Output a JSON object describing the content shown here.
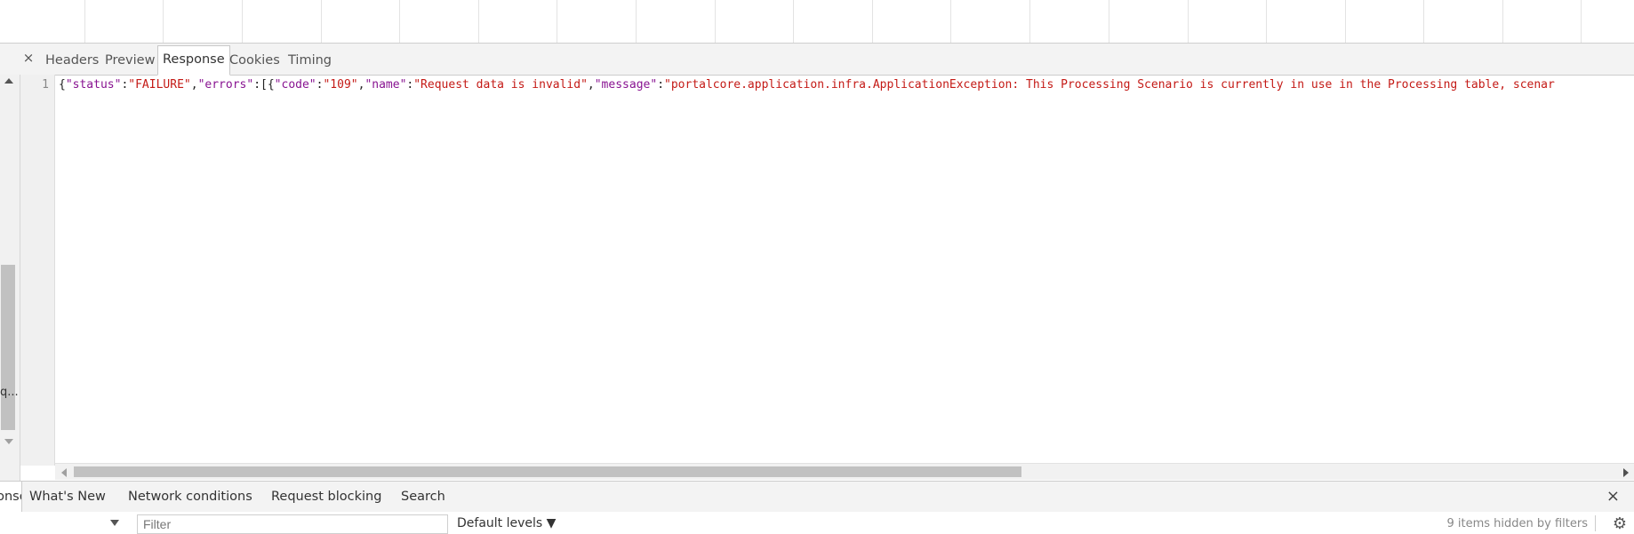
{
  "details_tabs": {
    "close": "×",
    "headers": "Headers",
    "preview": "Preview",
    "response": "Response",
    "cookies": "Cookies",
    "timing": "Timing",
    "active": "Response"
  },
  "request_list": {
    "truncated_label": "q..."
  },
  "response": {
    "line_number": "1",
    "tokens": [
      {
        "t": "{",
        "c": "p"
      },
      {
        "t": "\"status\"",
        "c": "k"
      },
      {
        "t": ":",
        "c": "p"
      },
      {
        "t": "\"FAILURE\"",
        "c": "s"
      },
      {
        "t": ",",
        "c": "p"
      },
      {
        "t": "\"errors\"",
        "c": "k"
      },
      {
        "t": ":[{",
        "c": "p"
      },
      {
        "t": "\"code\"",
        "c": "k"
      },
      {
        "t": ":",
        "c": "p"
      },
      {
        "t": "\"109\"",
        "c": "s"
      },
      {
        "t": ",",
        "c": "p"
      },
      {
        "t": "\"name\"",
        "c": "k"
      },
      {
        "t": ":",
        "c": "p"
      },
      {
        "t": "\"Request data is invalid\"",
        "c": "s"
      },
      {
        "t": ",",
        "c": "p"
      },
      {
        "t": "\"message\"",
        "c": "k"
      },
      {
        "t": ":",
        "c": "p"
      },
      {
        "t": "\"portalcore.application.infra.ApplicationException: This Processing Scenario is currently in use in the Processing table, scenar",
        "c": "s"
      }
    ]
  },
  "drawer": {
    "tabs": [
      "Console",
      "What's New",
      "Network conditions",
      "Request blocking",
      "Search"
    ],
    "close": "×"
  },
  "console_toolbar": {
    "filter_placeholder": "Filter",
    "levels_label": "Default levels ▼",
    "hidden_count": "9 items hidden by filters"
  },
  "colors": {
    "json_string": "#c41a16",
    "json_key": "#881391",
    "panel_bg": "#f3f3f3"
  },
  "icons": {
    "close": "close-icon",
    "settings": "gear-icon",
    "dropdown": "triangle-down-icon"
  }
}
